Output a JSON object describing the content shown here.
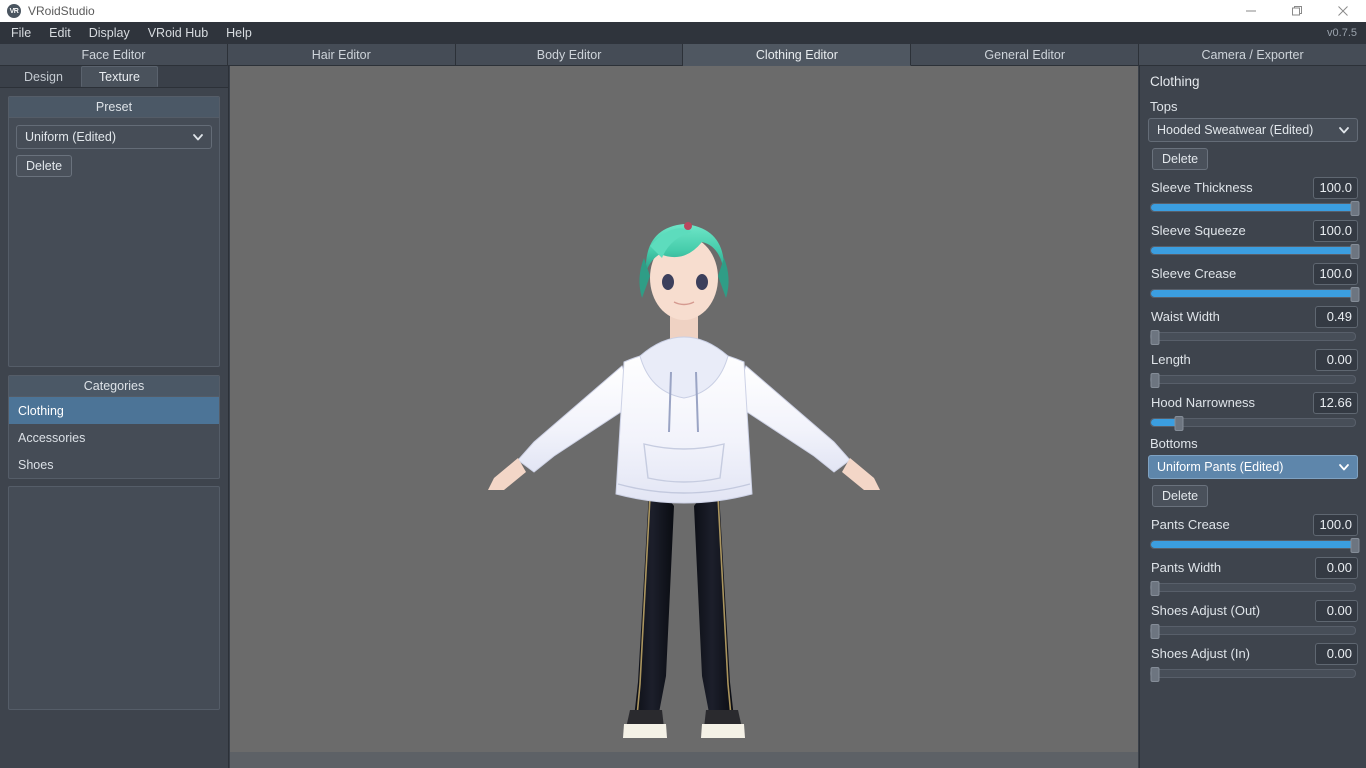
{
  "window": {
    "app_title": "VRoidStudio",
    "logo_text": "VR",
    "minimize_icon": "minimize-icon",
    "maximize_icon": "maximize-icon",
    "close_icon": "close-icon"
  },
  "menubar": {
    "items": [
      "File",
      "Edit",
      "Display",
      "VRoid Hub",
      "Help"
    ],
    "version": "v0.7.5"
  },
  "tabs": [
    {
      "label": "Face Editor",
      "active": false
    },
    {
      "label": "Hair Editor",
      "active": false
    },
    {
      "label": "Body Editor",
      "active": false
    },
    {
      "label": "Clothing Editor",
      "active": true
    },
    {
      "label": "General Editor",
      "active": false
    },
    {
      "label": "Camera / Exporter",
      "active": false
    }
  ],
  "left_panel": {
    "sub_tabs": [
      {
        "label": "Design",
        "active": false
      },
      {
        "label": "Texture",
        "active": true
      }
    ],
    "preset": {
      "header": "Preset",
      "dropdown_value": "Uniform (Edited)",
      "delete_label": "Delete"
    },
    "categories": {
      "header": "Categories",
      "items": [
        {
          "label": "Clothing",
          "selected": true
        },
        {
          "label": "Accessories",
          "selected": false
        },
        {
          "label": "Shoes",
          "selected": false
        }
      ]
    }
  },
  "right_panel": {
    "title": "Clothing",
    "tops": {
      "group_label": "Tops",
      "dropdown_value": "Hooded Sweatwear (Edited)",
      "dropdown_selected": false,
      "delete_label": "Delete",
      "params": [
        {
          "label": "Sleeve Thickness",
          "value": "100.0",
          "percent": 100
        },
        {
          "label": "Sleeve Squeeze",
          "value": "100.0",
          "percent": 100
        },
        {
          "label": "Sleeve Crease",
          "value": "100.0",
          "percent": 100
        },
        {
          "label": "Waist Width",
          "value": "0.49",
          "percent": 0.49
        },
        {
          "label": "Length",
          "value": "0.00",
          "percent": 0
        },
        {
          "label": "Hood Narrowness",
          "value": "12.66",
          "percent": 12.66
        }
      ]
    },
    "bottoms": {
      "group_label": "Bottoms",
      "dropdown_value": "Uniform Pants (Edited)",
      "dropdown_selected": true,
      "delete_label": "Delete",
      "params": [
        {
          "label": "Pants Crease",
          "value": "100.0",
          "percent": 100
        },
        {
          "label": "Pants Width",
          "value": "0.00",
          "percent": 0
        },
        {
          "label": "Shoes Adjust (Out)",
          "value": "0.00",
          "percent": 0
        },
        {
          "label": "Shoes Adjust (In)",
          "value": "0.00",
          "percent": 0
        }
      ]
    }
  },
  "viewport": {
    "background_color": "#6b6b6b",
    "model_description": "3D anime character in T-pose wearing white hooded sweatshirt and black pants",
    "hair_color": "#4fd4b5",
    "top_color": "#eceef8",
    "pants_color": "#14161e",
    "skin_color": "#f6ddd0"
  },
  "colors": {
    "accent_blue": "#3b9ee0",
    "selection_blue": "#4c7497",
    "panel_bg": "#3e444d",
    "tab_bg": "#454c56",
    "tab_active_bg": "#4f5761"
  }
}
